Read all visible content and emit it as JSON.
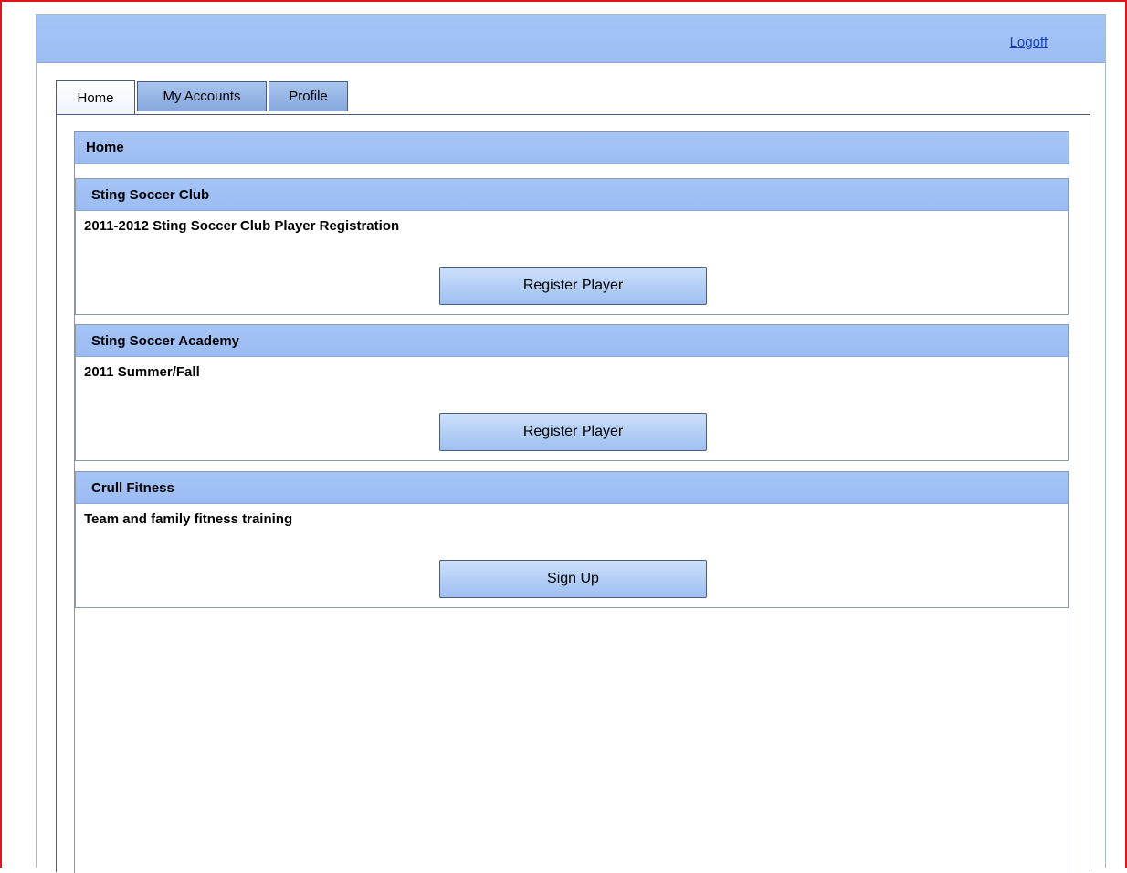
{
  "header": {
    "logoff_label": "Logoff"
  },
  "tabs": [
    {
      "label": "Home",
      "active": true
    },
    {
      "label": "My Accounts",
      "active": false
    },
    {
      "label": "Profile",
      "active": false
    }
  ],
  "home": {
    "title": "Home",
    "sections": [
      {
        "title": "Sting Soccer Club",
        "description": "2011-2012 Sting Soccer Club Player Registration",
        "button": "Register Player"
      },
      {
        "title": "Sting Soccer Academy",
        "description": "2011 Summer/Fall",
        "button": "Register Player"
      },
      {
        "title": "Crull Fitness",
        "description": "Team and family fitness training",
        "button": "Sign Up"
      }
    ]
  },
  "colors": {
    "highlight_border": "#e0141b",
    "header_blue": "#a4c4f6",
    "link_blue": "#1a3fbd"
  }
}
